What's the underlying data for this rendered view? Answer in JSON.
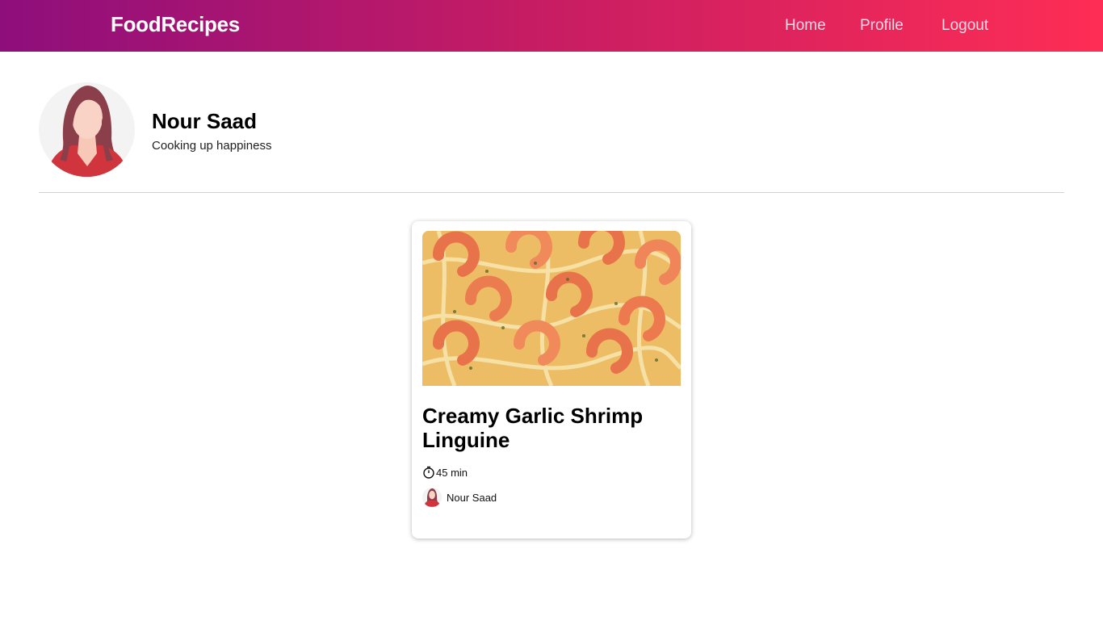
{
  "nav": {
    "brand": "FoodRecipes",
    "links": [
      "Home",
      "Profile",
      "Logout"
    ]
  },
  "profile": {
    "name": "Nour Saad",
    "bio": "Cooking up happiness"
  },
  "recipes": [
    {
      "title": "Creamy Garlic Shrimp Linguine",
      "time": "45 min",
      "author": "Nour Saad"
    }
  ],
  "colors": {
    "nav_gradient_start": "#8e0e7c",
    "nav_gradient_end": "#fe2d55"
  }
}
